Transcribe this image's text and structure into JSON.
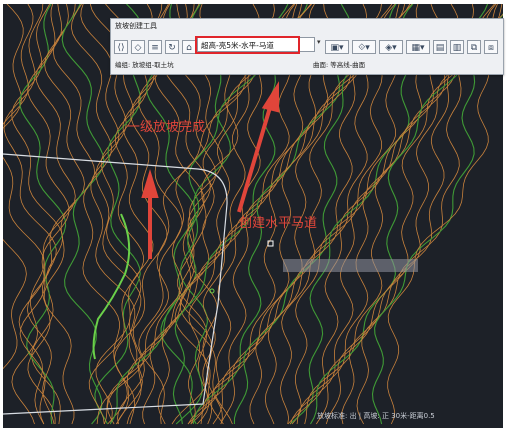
{
  "toolbar": {
    "title": "放坡创建工具",
    "name_value": "超高-亮5米-水平-马道",
    "dropdown_glyph": "▾",
    "status_left": "编组: 放坡组-取土坑",
    "status_right": "曲面: 等高线-曲面",
    "buttons_left": [
      "⟨⟩",
      "◇",
      "≡",
      "↻",
      "⌂"
    ],
    "buttons_right": [
      "▣▾",
      "⟐▾",
      "◈▾",
      "▦▾",
      "▤",
      "▥",
      "⧉",
      "⧈"
    ]
  },
  "annotations": {
    "first_slope": "一级放坡完成",
    "berm": "创建水平马道"
  },
  "tooltip": {
    "text": ""
  },
  "command": {
    "text": "放坡标准: 出 | 高坡: 正 30米-距离0.5"
  },
  "colors": {
    "background": "#1d2128",
    "contour_orange": "#c8823c",
    "contour_green": "#3f9a36",
    "highlight_green": "#6bd04a",
    "outline": "#d8dde3",
    "annotation_red": "#e0453a"
  }
}
